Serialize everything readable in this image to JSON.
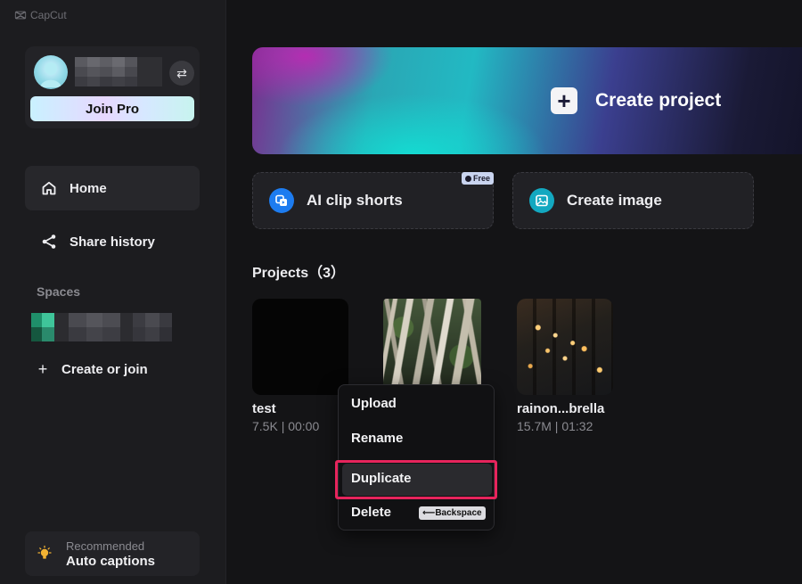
{
  "app": {
    "name": "CapCut"
  },
  "user": {
    "switch_icon": "⇄",
    "join_pro_label": "Join Pro"
  },
  "nav": {
    "home_label": "Home",
    "share_history_label": "Share history"
  },
  "spaces": {
    "label": "Spaces",
    "create_join_label": "Create or join"
  },
  "recommended": {
    "small": "Recommended",
    "big": "Auto captions"
  },
  "hero": {
    "label": "Create project"
  },
  "tools": [
    {
      "label": "AI clip shorts",
      "badge": "Free",
      "icon": "ai-clip-icon",
      "color": "#1d7cf0"
    },
    {
      "label": "Create image",
      "icon": "image-icon",
      "color": "#13a8c0"
    }
  ],
  "projects": {
    "heading": "Projects（3）",
    "items": [
      {
        "name": "test",
        "meta": "7.5K | 00:00"
      },
      {
        "name": "",
        "meta": ""
      },
      {
        "name": "rainon...brella",
        "meta": "15.7M | 01:32"
      }
    ]
  },
  "context_menu": {
    "items": [
      "Upload",
      "Rename",
      "Duplicate",
      "Delete"
    ],
    "shortcut": "⟵Backspace",
    "highlight_color": "#e6245c"
  }
}
